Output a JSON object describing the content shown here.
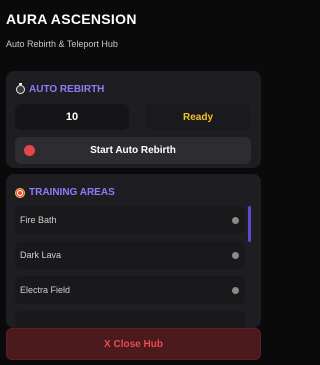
{
  "header": {
    "title": "AURA ASCENSION",
    "subtitle": "Auto Rebirth & Teleport Hub"
  },
  "auto_rebirth": {
    "heading": "AUTO REBIRTH",
    "icon": "stopwatch-icon",
    "amount_value": "10",
    "status": "Ready",
    "start_label": "Start Auto Rebirth"
  },
  "training_areas": {
    "heading": "TRAINING AREAS",
    "icon": "target-icon",
    "items": [
      {
        "label": "Fire Bath"
      },
      {
        "label": "Dark Lava"
      },
      {
        "label": "Electra Field"
      }
    ]
  },
  "footer": {
    "close_label": "X Close Hub"
  },
  "colors": {
    "accent": "#8f7cf5",
    "ready": "#f2c230",
    "close_text": "#f0484f",
    "start_dot": "#e8454a"
  }
}
